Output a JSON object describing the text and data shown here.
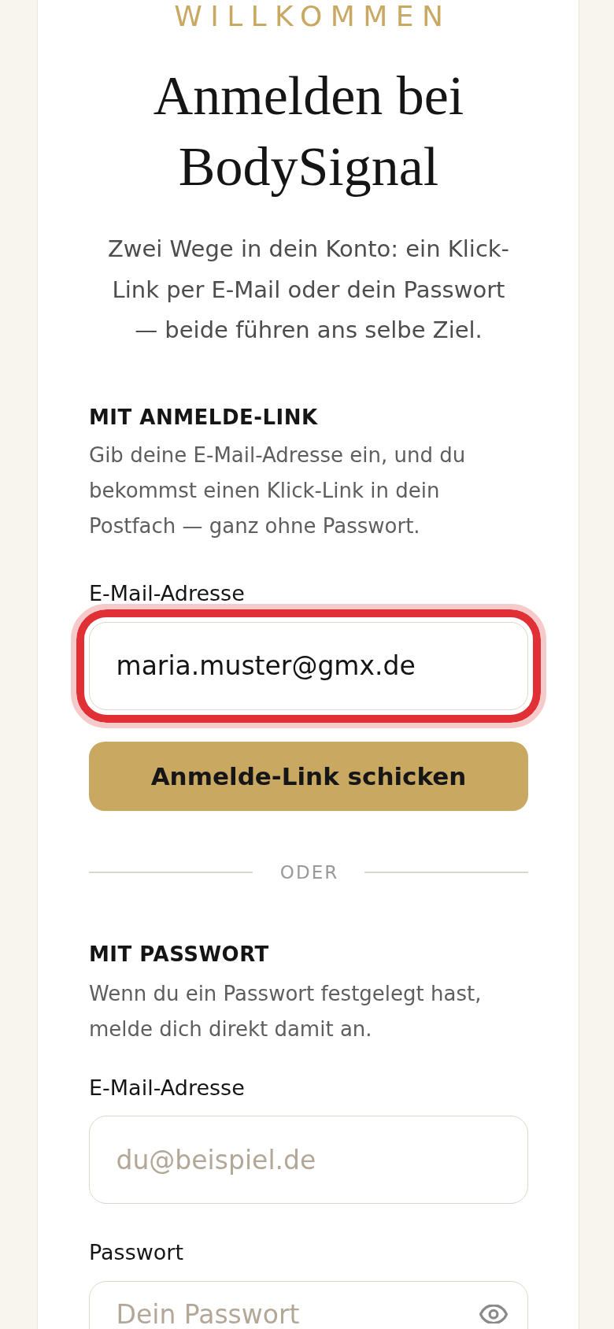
{
  "eyebrow": "WILLKOMMEN",
  "title": "Anmelden bei BodySignal",
  "subtitle": "Zwei Wege in dein Konto: ein Klick-Link per E-Mail oder dein Passwort — beide führen ans selbe Ziel.",
  "magic_link": {
    "heading": "MIT ANMELDE-LINK",
    "description": "Gib deine E-Mail-Adresse ein, und du bekommst einen Klick-Link in dein Postfach — ganz ohne Passwort.",
    "email": {
      "label": "E-Mail-Adresse",
      "value": "maria.muster@gmx.de",
      "highlighted": true
    },
    "button": "Anmelde-Link schicken"
  },
  "divider": "ODER",
  "password_login": {
    "heading": "MIT PASSWORT",
    "description": "Wenn du ein Passwort festgelegt hast, melde dich direkt damit an.",
    "email": {
      "label": "E-Mail-Adresse",
      "placeholder": "du@beispiel.de"
    },
    "password": {
      "label": "Passwort",
      "placeholder": "Dein Passwort"
    }
  }
}
